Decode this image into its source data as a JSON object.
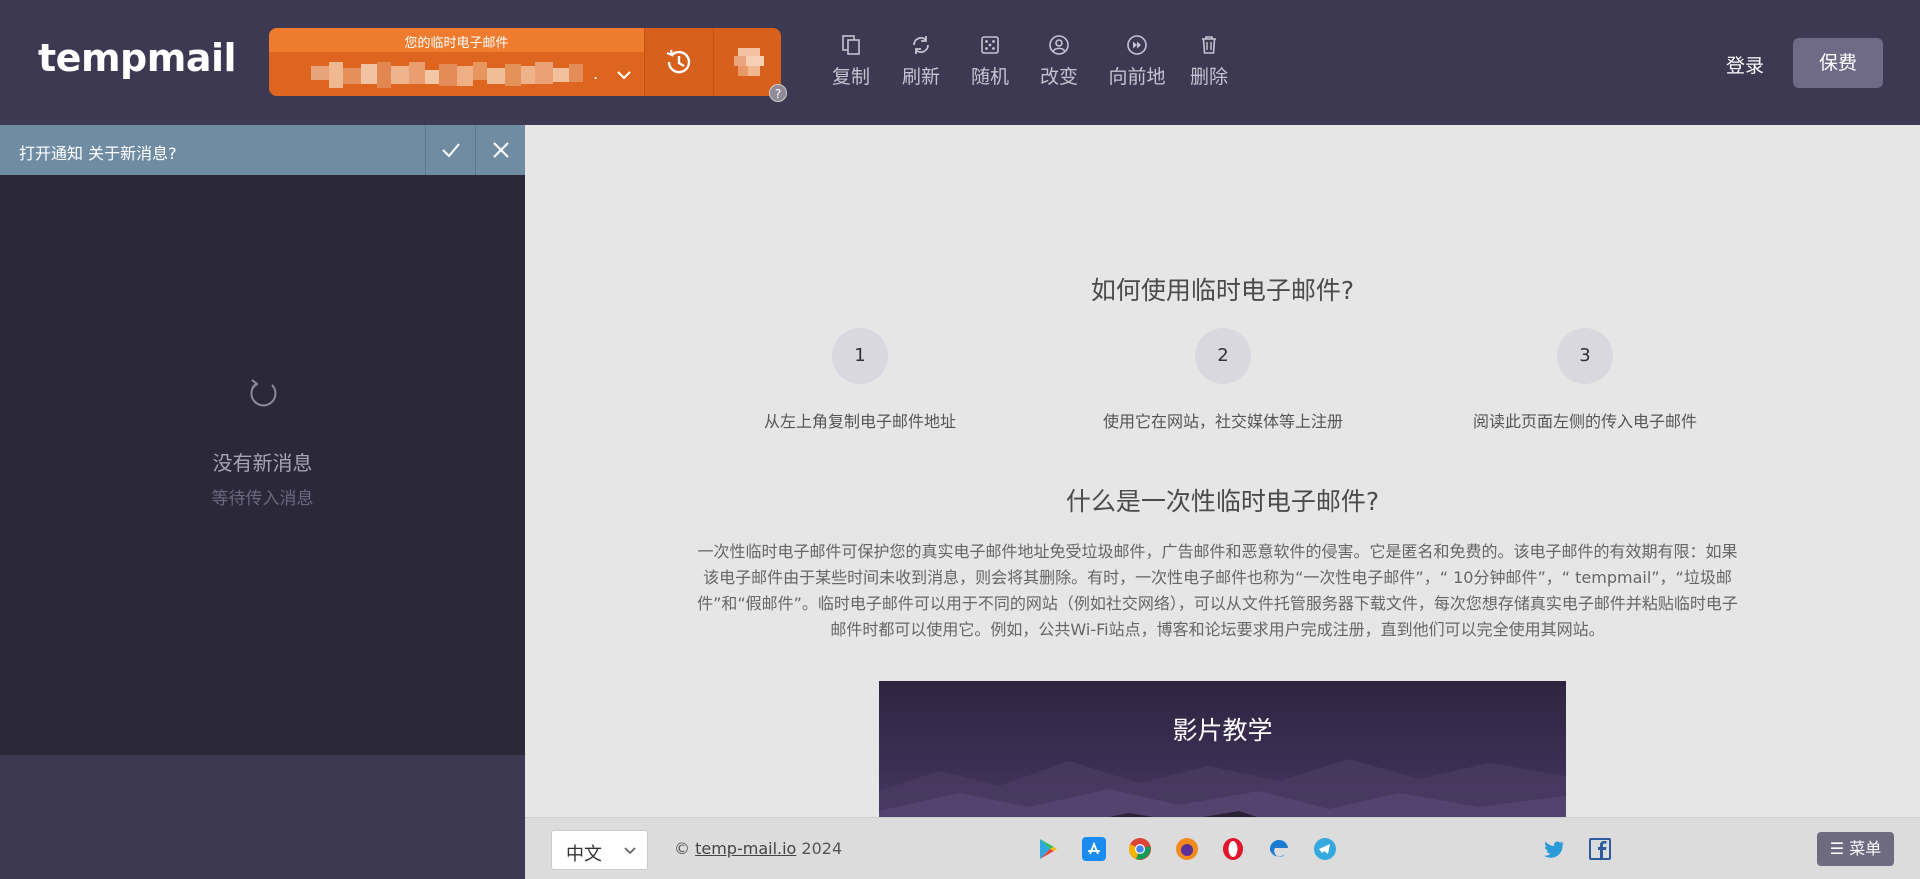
{
  "header": {
    "logo": "tempmail",
    "email_label": "您的临时电子邮件",
    "email_suffix": ".",
    "help": "?",
    "actions": [
      {
        "label": "复制",
        "icon": "copy-icon"
      },
      {
        "label": "刷新",
        "icon": "refresh-icon"
      },
      {
        "label": "随机",
        "icon": "dice-icon"
      },
      {
        "label": "改变",
        "icon": "user-circle-icon"
      },
      {
        "label": "向前地",
        "icon": "forward-icon"
      },
      {
        "label": "删除",
        "icon": "trash-icon"
      }
    ],
    "login": "登录",
    "donate": "保费"
  },
  "sidebar": {
    "notify_text": "打开通知 关于新消息?",
    "no_messages": "没有新消息",
    "waiting": "等待传入消息"
  },
  "main": {
    "how_title": "如何使用临时电子邮件?",
    "steps": [
      {
        "num": "1",
        "text": "从左上角复制电子邮件地址"
      },
      {
        "num": "2",
        "text": "使用它在网站，社交媒体等上注册"
      },
      {
        "num": "3",
        "text": "阅读此页面左侧的传入电子邮件"
      }
    ],
    "what_title": "什么是一次性临时电子邮件?",
    "description": "一次性临时电子邮件可保护您的真实电子邮件地址免受垃圾邮件，广告邮件和恶意软件的侵害。它是匿名和免费的。该电子邮件的有效期有限：如果该电子邮件由于某些时间未收到消息，则会将其删除。有时，一次性电子邮件也称为“一次性电子邮件”，“ 10分钟邮件”，“ tempmail”，“垃圾邮件”和“假邮件”。临时电子邮件可以用于不同的网站（例如社交网络），可以从文件托管服务器下载文件，每次您想存储真实电子邮件并粘贴临时电子邮件时都可以使用它。例如，公共Wi-Fi站点，博客和论坛要求用户完成注册，直到他们可以完全使用其网站。",
    "video_title": "影片教学"
  },
  "footer": {
    "language": "中文",
    "copyright_symbol": "©",
    "site_link": "temp-mail.io",
    "year": "2024",
    "stores": [
      "google-play-icon",
      "app-store-icon",
      "chrome-icon",
      "firefox-icon",
      "opera-icon",
      "edge-icon",
      "telegram-icon"
    ],
    "socials": [
      "twitter-icon",
      "facebook-icon"
    ],
    "menu": "菜单"
  },
  "colors": {
    "header_bg": "#3e3953",
    "email_orange": "#de651f",
    "sidebar_bg": "#2b2839",
    "notify_bar": "#6f8ca3",
    "main_bg": "#e6e6e7"
  }
}
